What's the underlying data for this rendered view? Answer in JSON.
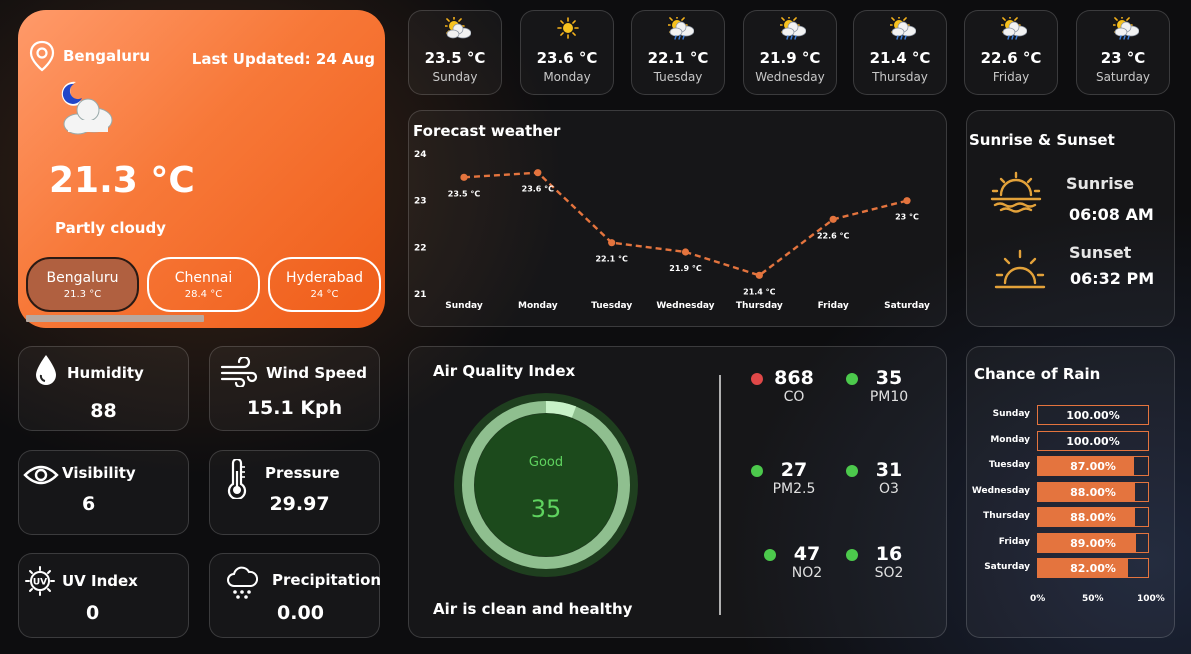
{
  "main": {
    "city": "Bengaluru",
    "last_updated": "Last Updated: 24 Aug",
    "temperature": "21.3 °C",
    "condition": "Partly cloudy",
    "cities": [
      {
        "name": "Bengaluru",
        "temp": "21.3 °C",
        "active": true
      },
      {
        "name": "Chennai",
        "temp": "28.4 °C",
        "active": false
      },
      {
        "name": "Hyderabad",
        "temp": "24 °C",
        "active": false
      }
    ],
    "icon": "moon-cloud-icon"
  },
  "days": [
    {
      "temp": "23.5 °C",
      "day": "Sunday",
      "icon": "sun-cloud-icon"
    },
    {
      "temp": "23.6 °C",
      "day": "Monday",
      "icon": "sun-icon"
    },
    {
      "temp": "22.1 °C",
      "day": "Tuesday",
      "icon": "sun-cloud-rain-icon"
    },
    {
      "temp": "21.9 °C",
      "day": "Wednesday",
      "icon": "sun-cloud-rain-icon"
    },
    {
      "temp": "21.4 °C",
      "day": "Thursday",
      "icon": "sun-cloud-rain-icon"
    },
    {
      "temp": "22.6 °C",
      "day": "Friday",
      "icon": "sun-cloud-rain-icon"
    },
    {
      "temp": "23 °C",
      "day": "Saturday",
      "icon": "sun-cloud-rain-icon"
    }
  ],
  "forecast": {
    "title": "Forecast weather"
  },
  "sun": {
    "title": "Sunrise & Sunset",
    "sunrise_label": "Sunrise",
    "sunrise_time": "06:08 AM",
    "sunset_label": "Sunset",
    "sunset_time": "06:32 PM"
  },
  "metrics": {
    "humidity": {
      "label": "Humidity",
      "value": "88"
    },
    "wind": {
      "label": "Wind Speed",
      "value": "15.1 Kph"
    },
    "visibility": {
      "label": "Visibility",
      "value": "6"
    },
    "pressure": {
      "label": "Pressure",
      "value": "29.97"
    },
    "uv": {
      "label": "UV Index",
      "value": "0"
    },
    "precip": {
      "label": "Precipitation",
      "value": "0.00"
    }
  },
  "aqi": {
    "title": "Air Quality Index",
    "status": "Good",
    "value": "35",
    "footer": "Air is clean and healthy",
    "pollutants": [
      {
        "value": "868",
        "name": "CO",
        "color": "#e04848"
      },
      {
        "value": "35",
        "name": "PM10",
        "color": "#4cc94c"
      },
      {
        "value": "27",
        "name": "PM2.5",
        "color": "#4cc94c"
      },
      {
        "value": "31",
        "name": "O3",
        "color": "#4cc94c"
      },
      {
        "value": "47",
        "name": "NO2",
        "color": "#4cc94c"
      },
      {
        "value": "16",
        "name": "SO2",
        "color": "#4cc94c"
      }
    ]
  },
  "rain": {
    "title": "Chance of Rain",
    "rows": [
      {
        "day": "Sunday",
        "pct": "100.00%",
        "value": 100
      },
      {
        "day": "Monday",
        "pct": "100.00%",
        "value": 100
      },
      {
        "day": "Tuesday",
        "pct": "87.00%",
        "value": 87
      },
      {
        "day": "Wednesday",
        "pct": "88.00%",
        "value": 88
      },
      {
        "day": "Thursday",
        "pct": "88.00%",
        "value": 88
      },
      {
        "day": "Friday",
        "pct": "89.00%",
        "value": 89
      },
      {
        "day": "Saturday",
        "pct": "82.00%",
        "value": 82
      }
    ],
    "axis": [
      "0%",
      "50%",
      "100%"
    ]
  },
  "chart_data": {
    "type": "line",
    "title": "Forecast weather",
    "categories": [
      "Sunday",
      "Monday",
      "Tuesday",
      "Wednesday",
      "Thursday",
      "Friday",
      "Saturday"
    ],
    "values": [
      23.5,
      23.6,
      22.1,
      21.9,
      21.4,
      22.6,
      23
    ],
    "data_labels": [
      "23.5 °C",
      "23.6 °C",
      "22.1 °C",
      "21.9 °C",
      "21.4 °C",
      "22.6 °C",
      "23 °C"
    ],
    "yticks": [
      21,
      22,
      23,
      24
    ],
    "ylim": [
      21,
      24
    ],
    "line_style": "dashed",
    "color": "#e4743e",
    "grid": false
  }
}
